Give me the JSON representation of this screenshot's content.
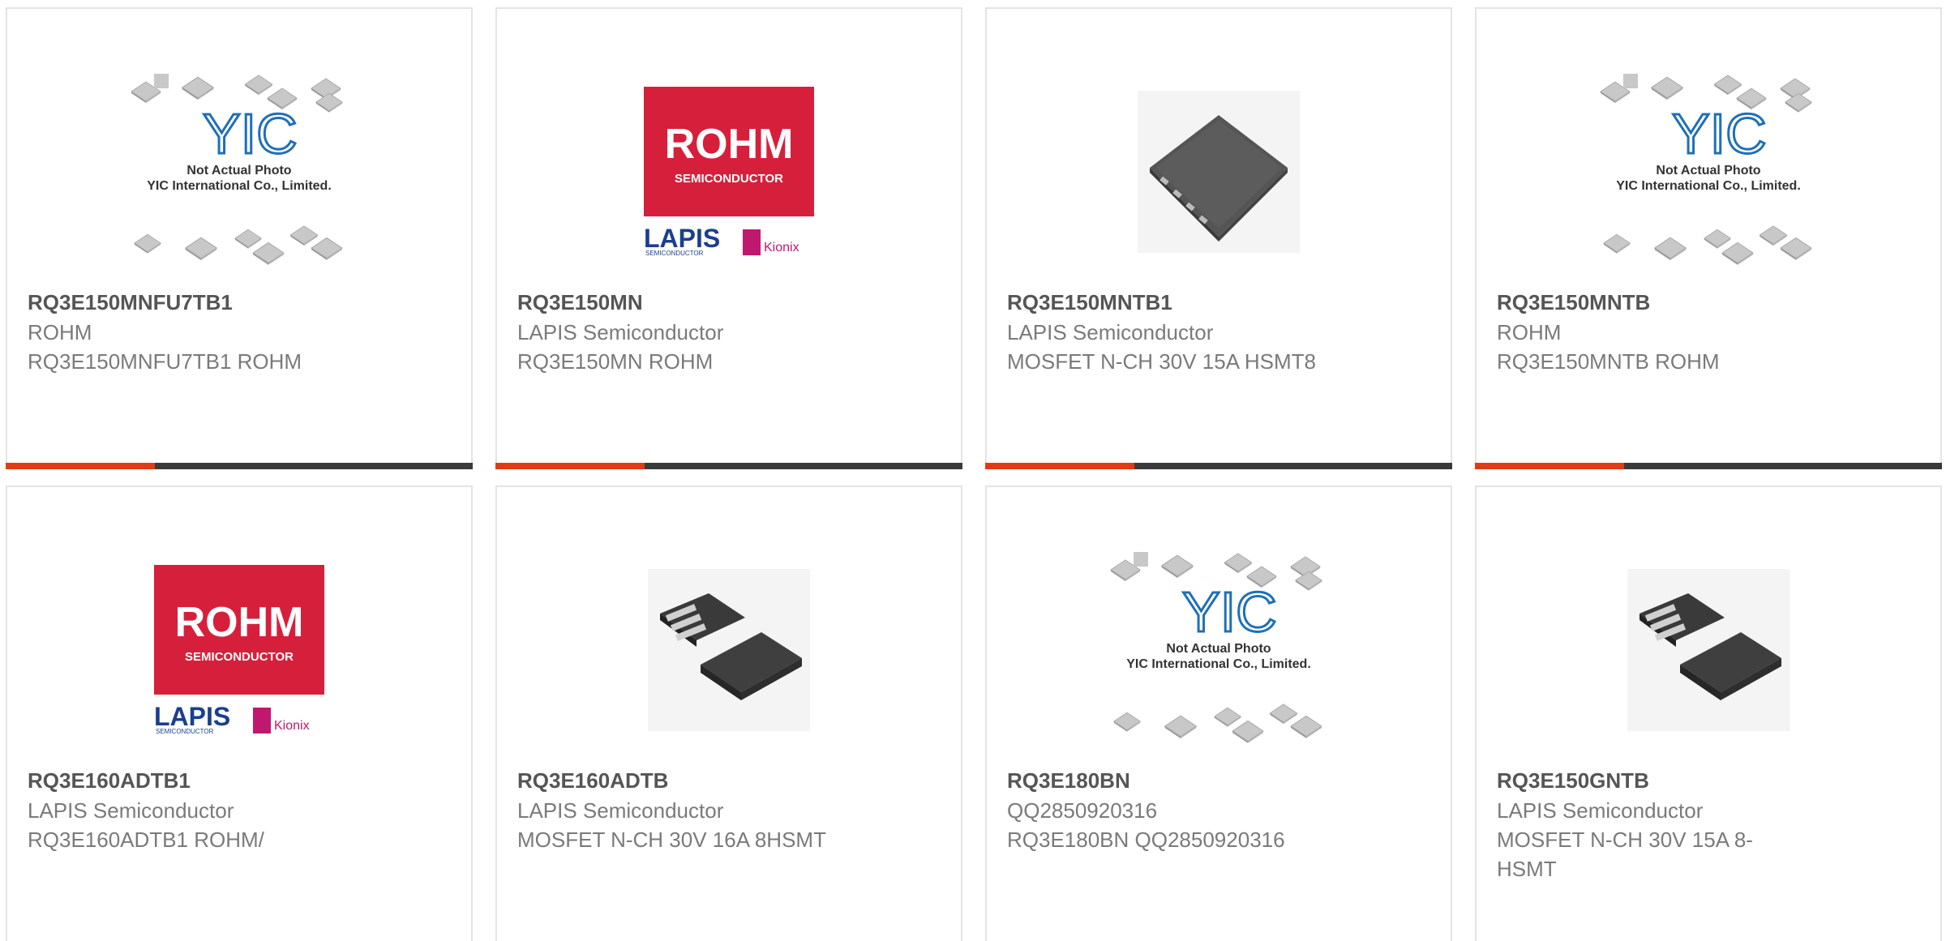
{
  "colors": {
    "accent": "#e13b16",
    "bar_dark": "#3a3a3a",
    "rohm_red": "#d6203b",
    "lapis_blue": "#1b3f8f",
    "kionix_pink": "#c0186f"
  },
  "placeholder": {
    "logo_text": "YIC",
    "line1": "Not Actual Photo",
    "line2": "YIC International Co., Limited."
  },
  "rohm_logo": {
    "brand": "ROHM",
    "sub": "SEMICONDUCTOR",
    "lapis": "LAPIS",
    "lapis_sub": "SEMICONDUCTOR",
    "kionix": "Kionix"
  },
  "products": [
    {
      "part_number": "RQ3E150MNFU7TB1",
      "manufacturer": "ROHM",
      "description": "RQ3E150MNFU7TB1 ROHM",
      "image": "not-actual-photo-placeholder"
    },
    {
      "part_number": "RQ3E150MN",
      "manufacturer": "LAPIS Semiconductor",
      "description": "RQ3E150MN ROHM",
      "image": "rohm-lapis-kionix-logo"
    },
    {
      "part_number": "RQ3E150MNTB1",
      "manufacturer": "LAPIS Semiconductor",
      "description": "MOSFET N-CH 30V 15A HSMT8",
      "image": "hsmt8-package-photo"
    },
    {
      "part_number": "RQ3E150MNTB",
      "manufacturer": "ROHM",
      "description": "RQ3E150MNTB ROHM",
      "image": "not-actual-photo-placeholder"
    },
    {
      "part_number": "RQ3E160ADTB1",
      "manufacturer": "LAPIS Semiconductor",
      "description": "RQ3E160ADTB1 ROHM/",
      "image": "rohm-lapis-kionix-logo"
    },
    {
      "part_number": "RQ3E160ADTB",
      "manufacturer": "LAPIS Semiconductor",
      "description": "MOSFET N-CH 30V 16A 8HSMT",
      "image": "hsmt-two-package-photo"
    },
    {
      "part_number": "RQ3E180BN",
      "manufacturer": "QQ2850920316",
      "description": "RQ3E180BN QQ2850920316",
      "image": "not-actual-photo-placeholder"
    },
    {
      "part_number": "RQ3E150GNTB",
      "manufacturer": "LAPIS Semiconductor",
      "description": "MOSFET N-CH 30V 15A 8-HSMT",
      "image": "hsmt-two-package-photo"
    }
  ]
}
